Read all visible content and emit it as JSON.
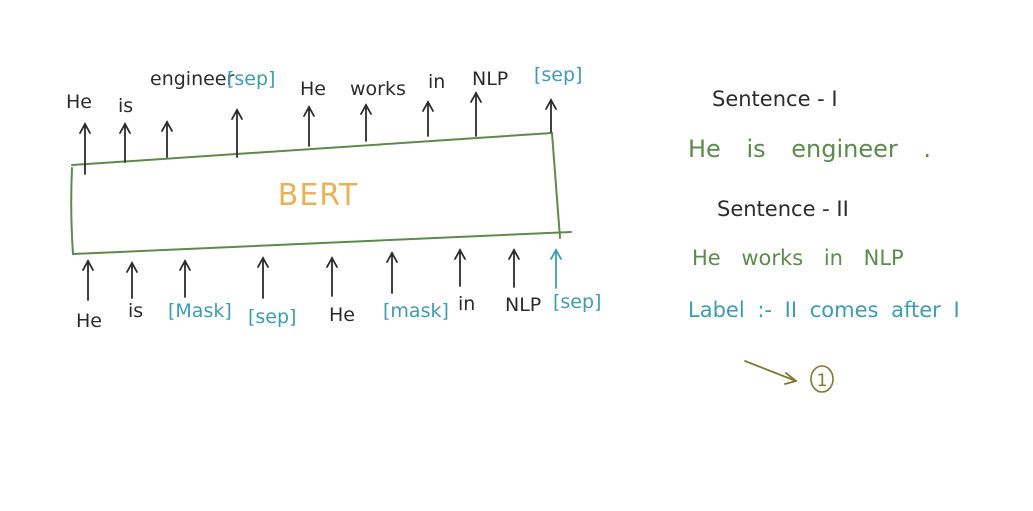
{
  "model_label": "BERT",
  "output_tokens": [
    {
      "text": "He",
      "color": "#2b2b2b"
    },
    {
      "text": "is",
      "color": "#2b2b2b"
    },
    {
      "text": "engineer",
      "color": "#2b2b2b"
    },
    {
      "text": "[sep]",
      "color": "#3f9bb0"
    },
    {
      "text": "He",
      "color": "#2b2b2b"
    },
    {
      "text": "works",
      "color": "#2b2b2b"
    },
    {
      "text": "in",
      "color": "#2b2b2b"
    },
    {
      "text": "NLP",
      "color": "#2b2b2b"
    },
    {
      "text": "[sep]",
      "color": "#3f9bb0"
    }
  ],
  "input_tokens": [
    {
      "text": "He",
      "color": "#2b2b2b"
    },
    {
      "text": "is",
      "color": "#2b2b2b"
    },
    {
      "text": "[Mask]",
      "color": "#3f9bb0"
    },
    {
      "text": "[sep]",
      "color": "#3f9bb0"
    },
    {
      "text": "He",
      "color": "#2b2b2b"
    },
    {
      "text": "[mask]",
      "color": "#3f9bb0"
    },
    {
      "text": "in",
      "color": "#2b2b2b"
    },
    {
      "text": "NLP",
      "color": "#2b2b2b"
    },
    {
      "text": "[sep]",
      "color": "#3f9bb0"
    }
  ],
  "notes": {
    "sentence1_title": "Sentence - I",
    "sentence1_text": "He is engineer .",
    "sentence2_title": "Sentence - II",
    "sentence2_text": "He works in NLP",
    "label_text": "Label :- II comes after I",
    "label_value": "1"
  },
  "colors": {
    "box": "#5e8a4e",
    "arrow": "#2b2b2b",
    "teal": "#3f9bb0",
    "green": "#5e8a4e",
    "orange": "#e8b25a",
    "olive": "#7d7a2e"
  }
}
